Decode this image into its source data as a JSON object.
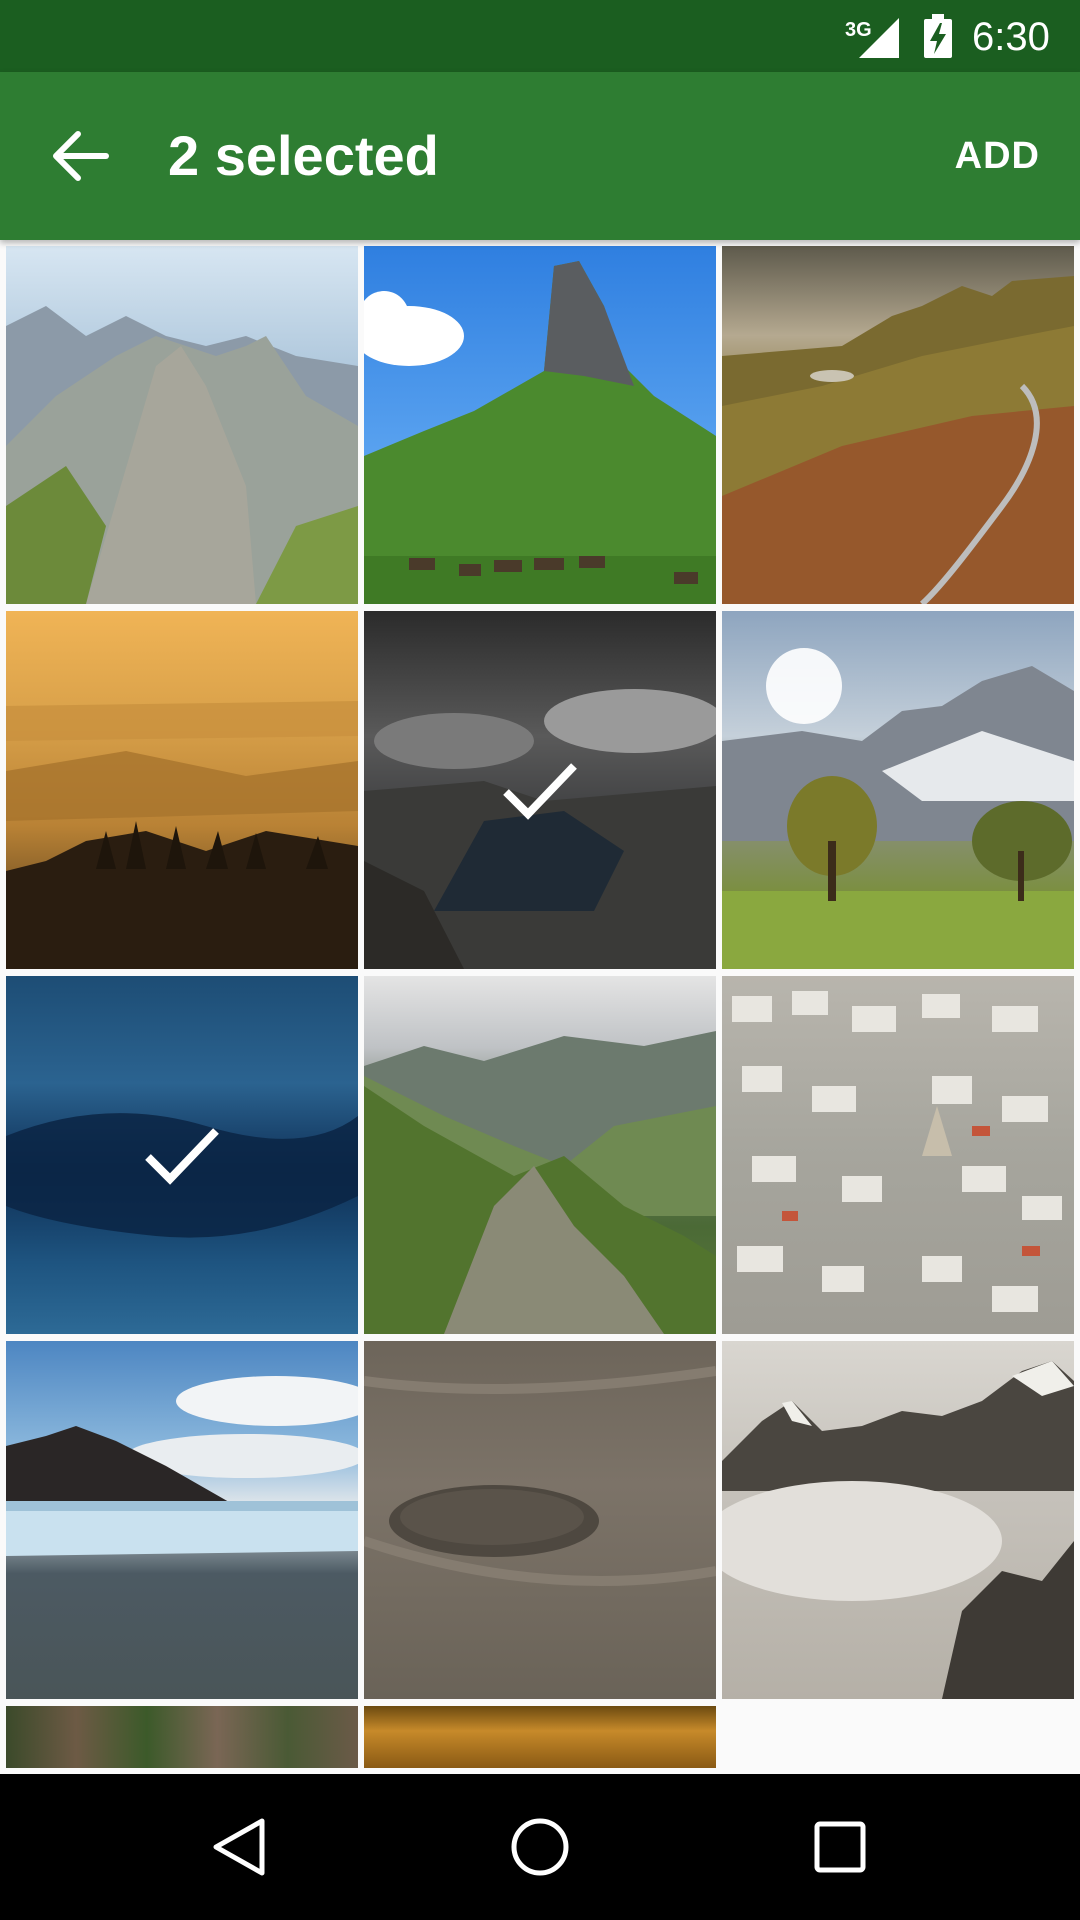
{
  "status_bar": {
    "network": "3G",
    "time": "6:30",
    "icons": [
      "signal-icon",
      "battery-charging-icon"
    ]
  },
  "app_bar": {
    "title": "2 selected",
    "back_icon": "arrow-back-icon",
    "action_label": "ADD",
    "color": "#2e7d32",
    "status_color": "#1b5e20"
  },
  "grid": {
    "tiles": [
      {
        "subject": "rocky alpine peaks",
        "selected": false
      },
      {
        "subject": "green mountain with grazing cows",
        "selected": false
      },
      {
        "subject": "highland valley with winding road",
        "selected": false
      },
      {
        "subject": "misty golden forest at sunrise",
        "selected": false
      },
      {
        "subject": "fjord under storm clouds",
        "selected": true
      },
      {
        "subject": "snowy mountains and autumn trees",
        "selected": false
      },
      {
        "subject": "blue underwater ice",
        "selected": true
      },
      {
        "subject": "green mountain ridges",
        "selected": false
      },
      {
        "subject": "dense town of white houses",
        "selected": false
      },
      {
        "subject": "glacier over a lake",
        "selected": false
      },
      {
        "subject": "footprint in sand",
        "selected": false
      },
      {
        "subject": "snow peaks above clouds",
        "selected": false
      },
      {
        "subject": "forest trunks",
        "selected": false
      },
      {
        "subject": "amber horizon",
        "selected": false
      }
    ],
    "selected_icon": "check-icon"
  },
  "nav_bar": {
    "icons": [
      "back-triangle-icon",
      "home-circle-icon",
      "recents-square-icon"
    ]
  }
}
